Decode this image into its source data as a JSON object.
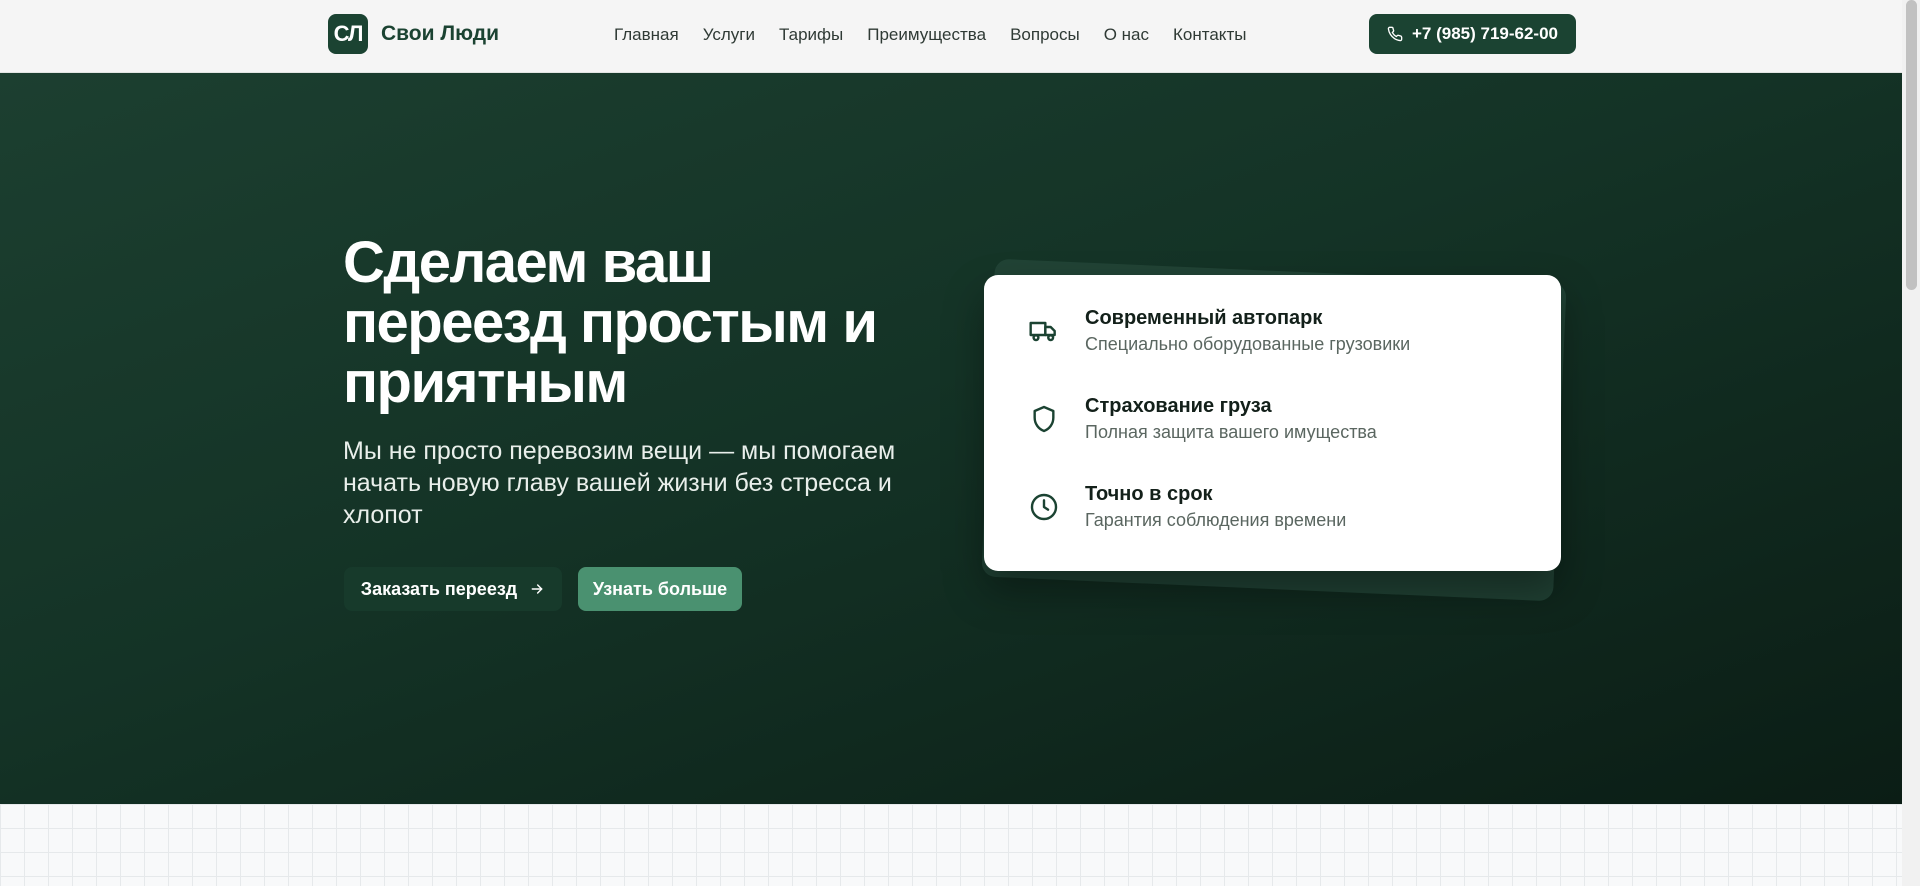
{
  "header": {
    "logo_mark": "СЛ",
    "logo_text": "Свои Люди",
    "nav": [
      "Главная",
      "Услуги",
      "Тарифы",
      "Преимущества",
      "Вопросы",
      "О нас",
      "Контакты"
    ],
    "phone": "+7 (985) 719-62-00"
  },
  "hero": {
    "title": "Сделаем ваш переезд простым и приятным",
    "subtitle": "Мы не просто перевозим вещи — мы помогаем начать новую главу вашей жизни без стресса и хлопот",
    "primary_button": "Заказать переезд",
    "secondary_button": "Узнать больше"
  },
  "features": [
    {
      "icon": "truck-icon",
      "title": "Современный автопарк",
      "desc": "Специально оборудованные грузовики"
    },
    {
      "icon": "shield-icon",
      "title": "Страхование груза",
      "desc": "Полная защита вашего имущества"
    },
    {
      "icon": "clock-icon",
      "title": "Точно в срок",
      "desc": "Гарантия соблюдения времени"
    }
  ],
  "colors": {
    "brand": "#1b4332",
    "accent": "#4a9170",
    "hero_dark": "#0b1d15"
  }
}
